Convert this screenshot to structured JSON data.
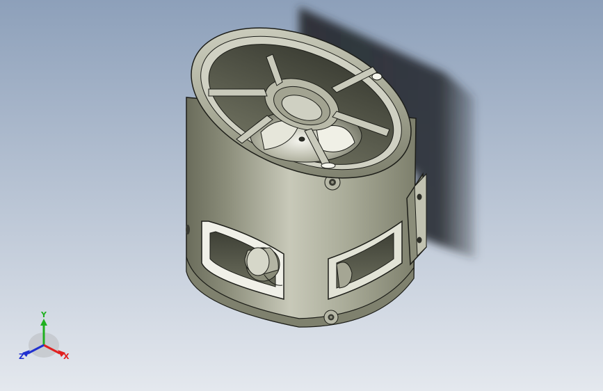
{
  "viewport": {
    "background_top": "#8da0ba",
    "background_bottom": "#e4e8ee",
    "shadow_color": "#23272c"
  },
  "model": {
    "body_dark": "#5f6152",
    "body_mid": "#9a9c8a",
    "body_light": "#c9cabb",
    "metal_light": "#f2f2ea",
    "metal_dark": "#484a3e",
    "edge_color": "#1c1d18"
  },
  "triad": {
    "x_label": "X",
    "y_label": "Y",
    "z_label": "Z",
    "x_color": "#e02020",
    "y_color": "#20b020",
    "z_color": "#2030d0"
  }
}
